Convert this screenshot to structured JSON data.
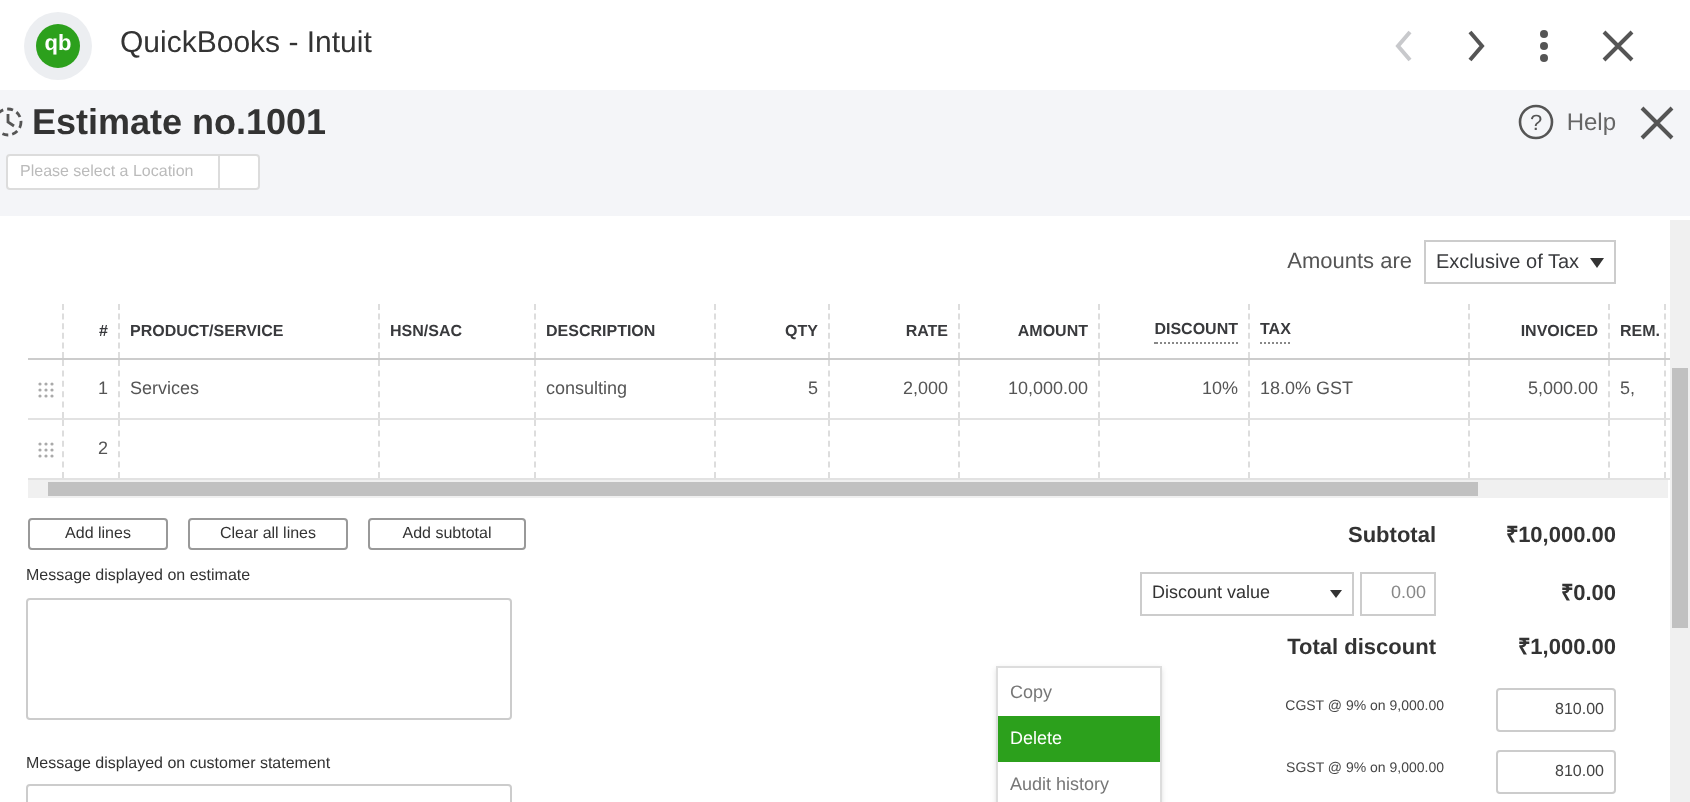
{
  "window": {
    "title": "QuickBooks - Intuit",
    "logo": "qb"
  },
  "header": {
    "title": "Estimate no.1001",
    "help": "Help",
    "help_icon": "?",
    "location_placeholder": "Please select a Location"
  },
  "amounts": {
    "label": "Amounts are",
    "value": "Exclusive of Tax"
  },
  "table": {
    "columns": [
      {
        "label": "#",
        "underlined": false
      },
      {
        "label": "PRODUCT/SERVICE",
        "underlined": false
      },
      {
        "label": "HSN/SAC",
        "underlined": false
      },
      {
        "label": "DESCRIPTION",
        "underlined": false
      },
      {
        "label": "QTY",
        "underlined": false
      },
      {
        "label": "RATE",
        "underlined": false
      },
      {
        "label": "AMOUNT",
        "underlined": false
      },
      {
        "label": "DISCOUNT",
        "underlined": true
      },
      {
        "label": "TAX",
        "underlined": true
      },
      {
        "label": "INVOICED",
        "underlined": false
      },
      {
        "label": "REM.",
        "underlined": false
      }
    ],
    "rows": [
      {
        "cells": [
          "1",
          "Services",
          "",
          "consulting",
          "5",
          "2,000",
          "10,000.00",
          "10%",
          "18.0% GST",
          "5,000.00",
          "5,"
        ]
      },
      {
        "cells": [
          "2",
          "",
          "",
          "",
          "",
          "",
          "",
          "",
          "",
          "",
          ""
        ]
      }
    ]
  },
  "buttons": [
    "Add lines",
    "Clear all lines",
    "Add subtotal"
  ],
  "messages": [
    {
      "label": "Message displayed on estimate"
    },
    {
      "label": "Message displayed on customer statement"
    }
  ],
  "totals": {
    "subtotal_label": "Subtotal",
    "subtotal": "₹10,000.00",
    "discount_type": "Discount value",
    "discount_input": "0.00",
    "discount_amount": "₹0.00",
    "total_discount_label": "Total discount",
    "total_discount": "₹1,000.00",
    "taxes": [
      {
        "label": "CGST @ 9% on 9,000.00",
        "value": "810.00"
      },
      {
        "label": "SGST @ 9% on 9,000.00",
        "value": "810.00"
      }
    ]
  },
  "menu": [
    {
      "label": "Copy",
      "selected": false
    },
    {
      "label": "Delete",
      "selected": true
    },
    {
      "label": "Audit history",
      "selected": false
    }
  ]
}
